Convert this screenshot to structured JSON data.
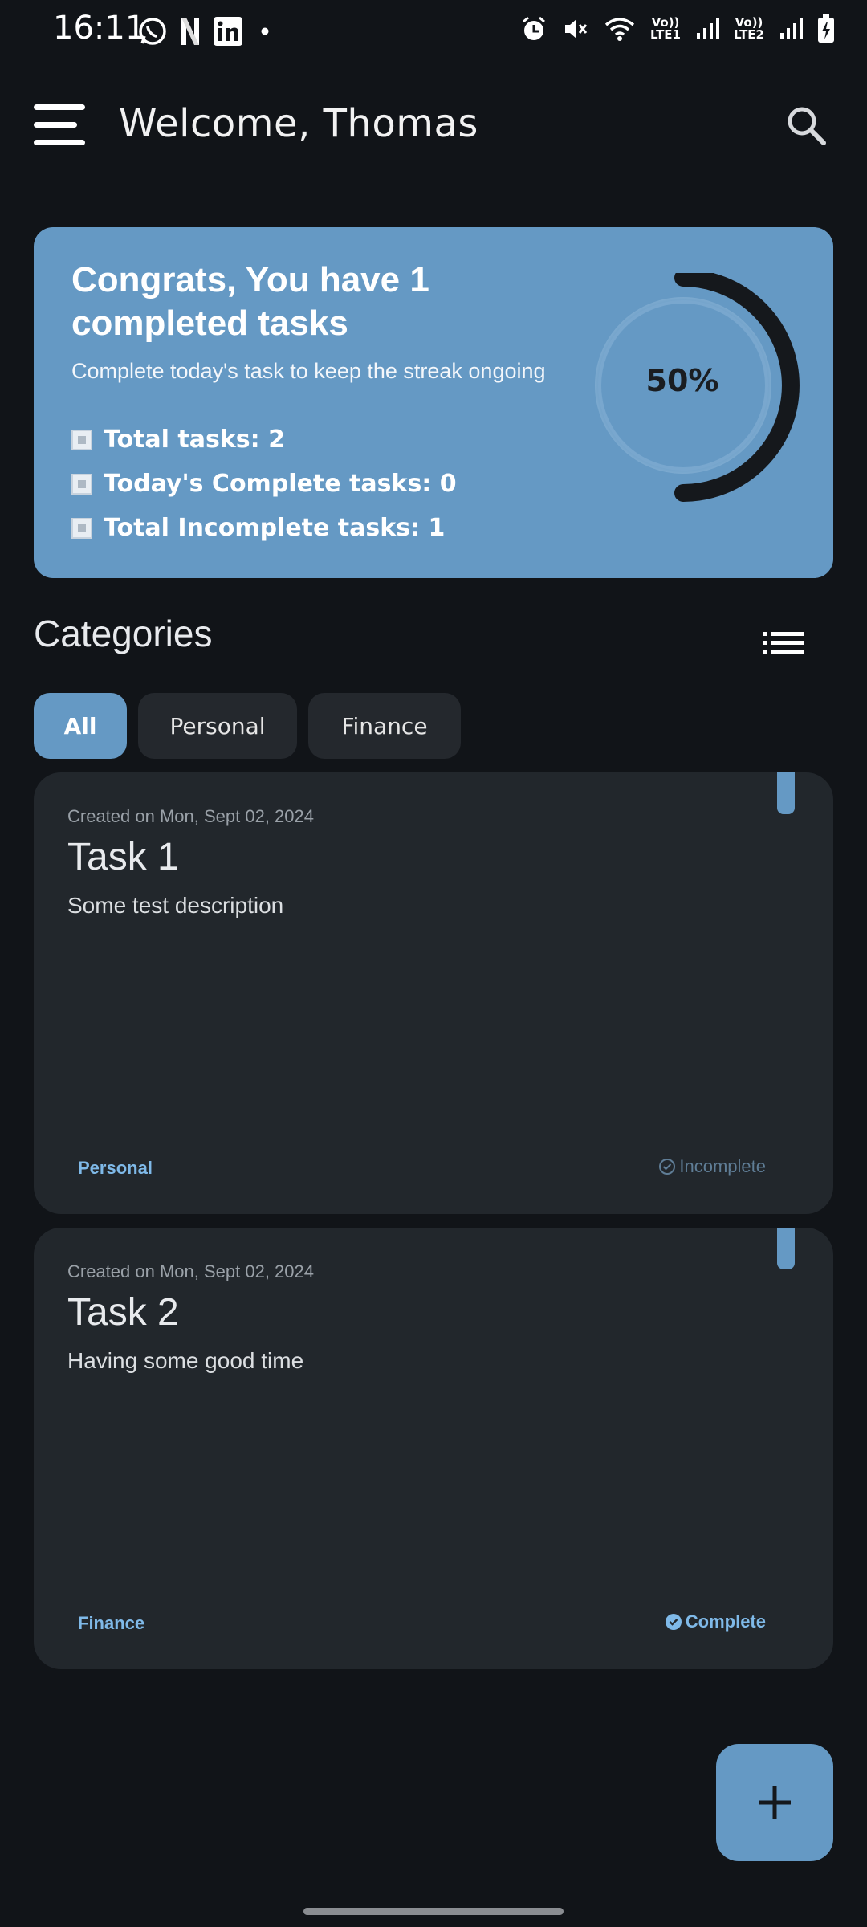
{
  "status_bar": {
    "time": "16:11",
    "network_1": "LTE1",
    "network_2": "LTE2",
    "volte": "Vo))"
  },
  "app_bar": {
    "title": "Welcome, Thomas"
  },
  "summary": {
    "title": "Congrats, You have 1 completed tasks",
    "subtitle": "Complete today's task to keep the streak ongoing",
    "stats": [
      "Total tasks: 2",
      "Today's Complete tasks: 0",
      "Total Incomplete tasks: 1"
    ],
    "progress_label": "50%",
    "progress_value": 0.5
  },
  "categories": {
    "title": "Categories",
    "chips": [
      "All",
      "Personal",
      "Finance"
    ],
    "selected": "All"
  },
  "tasks": [
    {
      "created": "Created on Mon, Sept 02, 2024",
      "title": "Task 1",
      "description": "Some test description",
      "category": "Personal",
      "status": "Incomplete"
    },
    {
      "created": "Created on Mon, Sept 02, 2024",
      "title": "Task 2",
      "description": "Having some good time",
      "category": "Finance",
      "status": "Complete"
    }
  ],
  "colors": {
    "background": "#111418",
    "accent": "#6599c4",
    "card": "#22272c",
    "category_text": "#7fb9e8"
  }
}
